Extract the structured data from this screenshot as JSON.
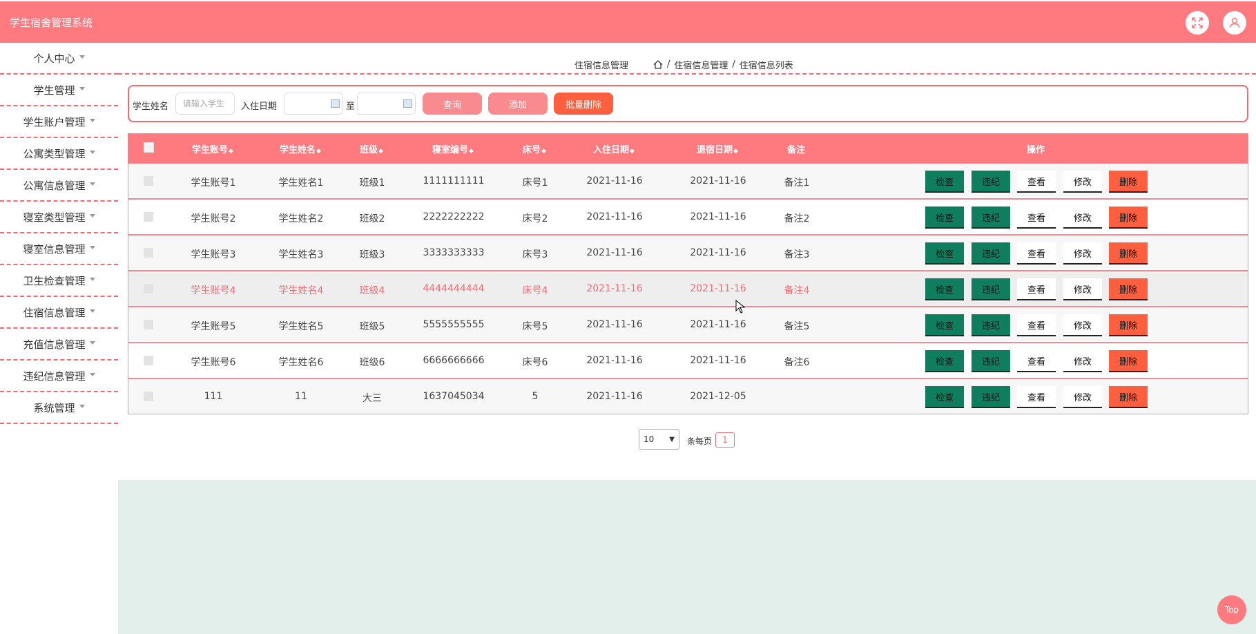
{
  "app": {
    "title": "学生宿舍管理系统"
  },
  "sidebar": {
    "items": [
      {
        "label": "个人中心"
      },
      {
        "label": "学生管理"
      },
      {
        "label": "学生账户管理"
      },
      {
        "label": "公寓类型管理"
      },
      {
        "label": "公寓信息管理"
      },
      {
        "label": "寝室类型管理"
      },
      {
        "label": "寝室信息管理"
      },
      {
        "label": "卫生检查管理"
      },
      {
        "label": "住宿信息管理"
      },
      {
        "label": "充值信息管理"
      },
      {
        "label": "违纪信息管理"
      },
      {
        "label": "系统管理"
      }
    ]
  },
  "breadcrumb": {
    "title": "住宿信息管理",
    "path1": "住宿信息管理",
    "sep": "/",
    "path2": "住宿信息列表"
  },
  "search": {
    "name_label": "学生姓名",
    "name_placeholder": "请输入学生",
    "date_label": "入住日期",
    "to_label": "至",
    "query": "查询",
    "add": "添加",
    "batch_delete": "批量删除"
  },
  "table": {
    "headers": {
      "account": "学生账号",
      "name": "学生姓名",
      "class": "班级",
      "room": "寝室编号",
      "bed": "床号",
      "checkin": "入住日期",
      "checkout": "退宿日期",
      "note": "备注",
      "ops": "操作"
    },
    "sort_mark": "◆",
    "actions": {
      "inspect": "检查",
      "violation": "违纪",
      "view": "查看",
      "edit": "修改",
      "delete": "删除"
    },
    "rows": [
      {
        "account": "学生账号1",
        "name": "学生姓名1",
        "class": "班级1",
        "room": "1111111111",
        "bed": "床号1",
        "checkin": "2021-11-16",
        "checkout": "2021-11-16",
        "note": "备注1"
      },
      {
        "account": "学生账号2",
        "name": "学生姓名2",
        "class": "班级2",
        "room": "2222222222",
        "bed": "床号2",
        "checkin": "2021-11-16",
        "checkout": "2021-11-16",
        "note": "备注2"
      },
      {
        "account": "学生账号3",
        "name": "学生姓名3",
        "class": "班级3",
        "room": "3333333333",
        "bed": "床号3",
        "checkin": "2021-11-16",
        "checkout": "2021-11-16",
        "note": "备注3"
      },
      {
        "account": "学生账号4",
        "name": "学生姓名4",
        "class": "班级4",
        "room": "4444444444",
        "bed": "床号4",
        "checkin": "2021-11-16",
        "checkout": "2021-11-16",
        "note": "备注4"
      },
      {
        "account": "学生账号5",
        "name": "学生姓名5",
        "class": "班级5",
        "room": "5555555555",
        "bed": "床号5",
        "checkin": "2021-11-16",
        "checkout": "2021-11-16",
        "note": "备注5"
      },
      {
        "account": "学生账号6",
        "name": "学生姓名6",
        "class": "班级6",
        "room": "6666666666",
        "bed": "床号6",
        "checkin": "2021-11-16",
        "checkout": "2021-11-16",
        "note": "备注6"
      },
      {
        "account": "111",
        "name": "11",
        "class": "大三",
        "room": "1637045034",
        "bed": "5",
        "checkin": "2021-11-16",
        "checkout": "2021-12-05",
        "note": ""
      }
    ]
  },
  "pagination": {
    "page_size": "10",
    "per_page_label": "条每页",
    "current_page": "1"
  },
  "top_button": "Top",
  "colors": {
    "primary": "#ff7a7f",
    "green": "#0e7e5e",
    "orange": "#fd5f3f",
    "panel": "#e3efea"
  }
}
